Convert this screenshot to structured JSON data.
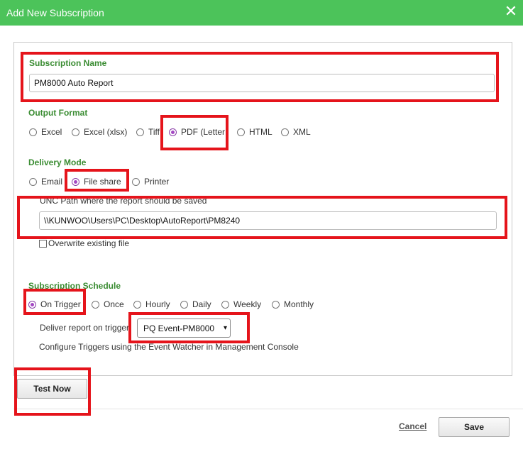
{
  "dialog": {
    "title": "Add New Subscription",
    "close_icon": "close-icon"
  },
  "subscription_name": {
    "label": "Subscription Name",
    "value": "PM8000 Auto Report"
  },
  "output_format": {
    "label": "Output Format",
    "options": [
      "Excel",
      "Excel (xlsx)",
      "Tiff",
      "PDF (Letter",
      "HTML",
      "XML"
    ],
    "selected": "PDF (Letter"
  },
  "delivery_mode": {
    "label": "Delivery Mode",
    "options": [
      "Email",
      "File share",
      "Printer"
    ],
    "selected": "File share"
  },
  "unc_path": {
    "label": "UNC Path where the report should be saved",
    "value": "\\\\KUNWOO\\Users\\PC\\Desktop\\AutoReport\\PM8240",
    "overwrite_label": "Overwrite existing file",
    "overwrite_checked": false
  },
  "schedule": {
    "label": "Subscription Schedule",
    "options": [
      "On Trigger",
      "Once",
      "Hourly",
      "Daily",
      "Weekly",
      "Monthly"
    ],
    "selected": "On Trigger",
    "trigger_label": "Deliver report on trigger",
    "trigger_value": "PQ Event-PM8000",
    "help_text": "Configure Triggers using the Event Watcher in Management Console"
  },
  "buttons": {
    "test_now": "Test Now",
    "cancel": "Cancel",
    "save": "Save"
  },
  "colors": {
    "title_bar": "#4cc35a",
    "section_label": "#3a8c32",
    "highlight": "#e5141b",
    "radio_selected": "#a347c3"
  }
}
